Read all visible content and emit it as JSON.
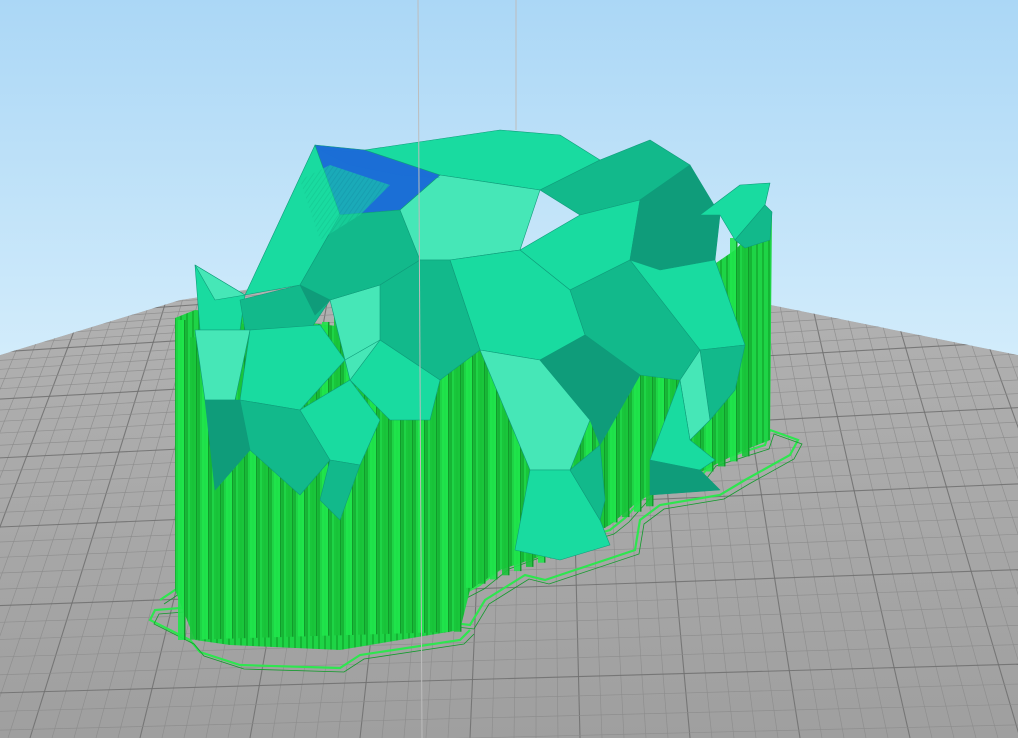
{
  "app": {
    "view": "3d-slice-preview"
  },
  "colors": {
    "sky_top": "#abd7f6",
    "sky_bottom": "#d2ecfb",
    "bed_base": "#a5a5a5",
    "bed_grid_minor": "#8c8c8c",
    "bed_grid_major": "#6f6f6f",
    "model_main": "#19dba0",
    "model_dark": "#12b98b",
    "model_shadow": "#0f9c7a",
    "model_highlight": "#46e7b7",
    "model_blue": "#1b6fd6",
    "support_bright": "#1fe64b",
    "support_mid": "#18c43a",
    "support_dark": "#119b2b",
    "brim_outline": "#2ee64f",
    "guide_line": "#bdbdbd"
  },
  "scene": {
    "guides": 2,
    "support_columns": 48,
    "model_faces": 40,
    "brim_loops": 2
  }
}
